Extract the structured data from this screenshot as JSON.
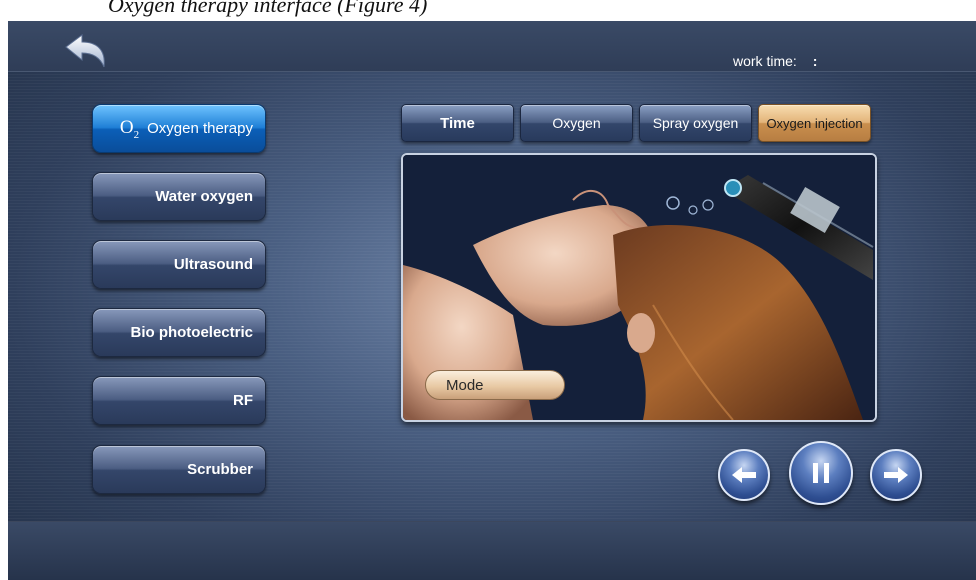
{
  "caption": "Oxygen therapy interface (Figure 4)",
  "header": {
    "work_time_label": "work time:",
    "work_time_value": ":"
  },
  "sidebar": {
    "items": [
      {
        "label": "Oxygen therapy",
        "icon": "O2",
        "active": true
      },
      {
        "label": "Water oxygen",
        "active": false
      },
      {
        "label": "Ultrasound",
        "active": false
      },
      {
        "label": "Bio photoelectric",
        "active": false
      },
      {
        "label": "RF",
        "active": false
      },
      {
        "label": "Scrubber",
        "active": false
      }
    ]
  },
  "tabs": [
    {
      "label": "Time",
      "active": false
    },
    {
      "label": "Oxygen",
      "active": false
    },
    {
      "label": "Spray oxygen",
      "active": false
    },
    {
      "label": "Oxygen injection",
      "active": true
    }
  ],
  "viewer": {
    "mode_label": "Mode"
  },
  "icons": {
    "back": "back-arrow-icon",
    "prev": "left-arrow-icon",
    "pause": "pause-icon",
    "next": "right-arrow-icon"
  },
  "colors": {
    "active_sidebar": "#1f7fd6",
    "active_tab": "#e3b47a",
    "background": "#4a5f82"
  }
}
